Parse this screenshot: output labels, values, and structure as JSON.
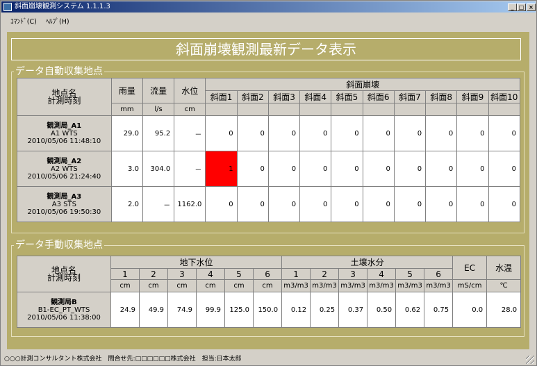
{
  "window": {
    "title": "斜面崩壊観測システム 1.1.1.3"
  },
  "menu": [
    {
      "label": "ｺﾏﾝﾄﾞ(C)"
    },
    {
      "label": "ﾍﾙﾌﾟ(H)"
    }
  ],
  "banner": "斜面崩壊観測最新データ表示",
  "auto": {
    "group_label": "データ自動収集地点",
    "header": {
      "station": "地点名",
      "time": "計測時刻",
      "rain": "雨量",
      "flow": "流量",
      "level": "水位",
      "rain_unit": "mm",
      "flow_unit": "l/s",
      "level_unit": "cm",
      "slope_group": "斜面崩壊",
      "slopes": [
        "斜面1",
        "斜面2",
        "斜面3",
        "斜面4",
        "斜面5",
        "斜面6",
        "斜面7",
        "斜面8",
        "斜面9",
        "斜面10"
      ]
    },
    "rows": [
      {
        "name": "観測局_A1",
        "code": "A1 WTS",
        "time": "2010/05/06 11:48:10",
        "rain": "29.0",
        "flow": "95.2",
        "level": "－",
        "slopes": [
          "0",
          "0",
          "0",
          "0",
          "0",
          "0",
          "0",
          "0",
          "0",
          "0"
        ],
        "alert_color": "#ff0000"
      },
      {
        "name": "観測局_A2",
        "code": "A2 WTS",
        "time": "2010/05/06 21:24:40",
        "rain": "3.0",
        "flow": "304.0",
        "level": "－",
        "slopes": [
          "1",
          "0",
          "0",
          "0",
          "0",
          "0",
          "0",
          "0",
          "0",
          "0"
        ],
        "alert_color": "#ff0000"
      },
      {
        "name": "観測局_A3",
        "code": "A3 STS",
        "time": "2010/05/06 19:50:30",
        "rain": "2.0",
        "flow": "－",
        "level": "1162.0",
        "slopes": [
          "0",
          "0",
          "0",
          "0",
          "0",
          "0",
          "0",
          "0",
          "0",
          "0"
        ],
        "alert_color": "#ff0000"
      }
    ]
  },
  "manual": {
    "group_label": "データ手動収集地点",
    "header": {
      "station": "地点名",
      "time": "計測時刻",
      "gw_group": "地下水位",
      "soil_group": "土壌水分",
      "ec": "EC",
      "temp": "水温",
      "gw_numbers": [
        "1",
        "2",
        "3",
        "4",
        "5",
        "6"
      ],
      "soil_numbers": [
        "1",
        "2",
        "3",
        "4",
        "5",
        "6"
      ],
      "gw_unit": "cm",
      "soil_unit": "m3/m3",
      "ec_unit": "mS/cm",
      "temp_unit": "℃"
    },
    "rows": [
      {
        "name": "観測局B",
        "code": "B1-EC_PT_WTS",
        "time": "2010/05/06 11:38:00",
        "gw": [
          "24.9",
          "49.9",
          "74.9",
          "99.9",
          "125.0",
          "150.0"
        ],
        "soil": [
          "0.12",
          "0.25",
          "0.37",
          "0.50",
          "0.62",
          "0.75"
        ],
        "ec": "0.0",
        "temp": "28.0"
      }
    ]
  },
  "status": {
    "text": "○○○計測コンサルタント株式会社　問合せ先:□□□□□□株式会社　担当:日本太郎"
  }
}
